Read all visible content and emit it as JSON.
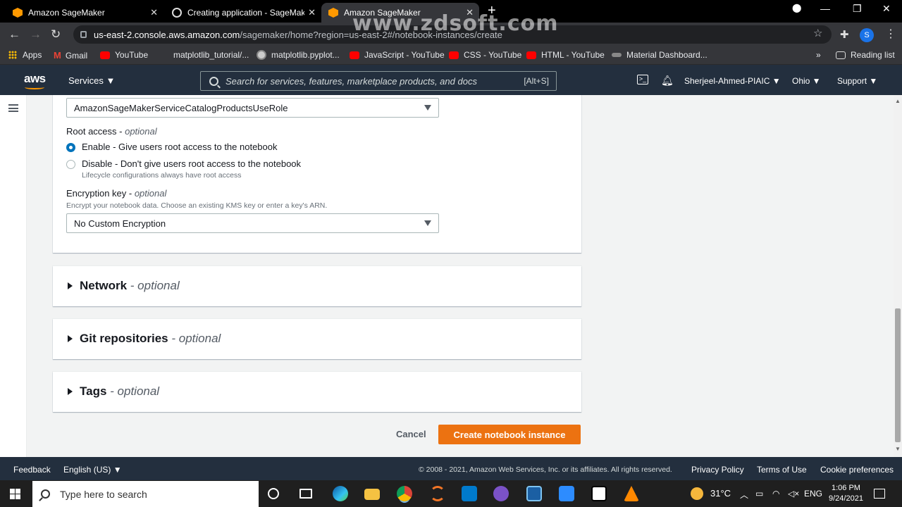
{
  "browser": {
    "tabs": [
      {
        "title": "Amazon SageMaker",
        "icon": "aws-hex-icon"
      },
      {
        "title": "Creating application - SageMake",
        "icon": "globe-icon"
      },
      {
        "title": "Amazon SageMaker",
        "icon": "aws-hex-icon"
      }
    ],
    "close_glyph": "✕",
    "url_host": "us-east-2.console.aws.amazon.com",
    "url_path": "/sagemaker/home?region=us-east-2#/notebook-instances/create",
    "watermark": "www.zdsoft.com",
    "profile_initial": "S",
    "bookmarks": [
      "Apps",
      "Gmail",
      "YouTube",
      "matplotlib_tutorial/...",
      "matplotlib.pyplot...",
      "JavaScript - YouTube",
      "CSS - YouTube",
      "HTML - YouTube",
      "Material Dashboard...",
      "Reading list"
    ]
  },
  "aws_header": {
    "logo": "aws",
    "services": "Services ▼",
    "search_placeholder": "Search for services, features, marketplace products, and docs",
    "search_shortcut": "[Alt+S]",
    "account": "Sherjeel-Ahmed-PIAIC ▼",
    "region": "Ohio ▼",
    "support": "Support ▼"
  },
  "form": {
    "role_select": "AmazonSageMakerServiceCatalogProductsUseRole",
    "root_access_label": "Root access - ",
    "optional": "optional",
    "enable_label": "Enable - Give users root access to the notebook",
    "disable_label": "Disable - Don't give users root access to the notebook",
    "disable_desc": "Lifecycle configurations always have root access",
    "encryption_label": "Encryption key - ",
    "encryption_desc": "Encrypt your notebook data. Choose an existing KMS key or enter a key's ARN.",
    "encryption_select": "No Custom Encryption",
    "sections": [
      {
        "title": "Network",
        "optional": " - optional"
      },
      {
        "title": "Git repositories",
        "optional": " - optional"
      },
      {
        "title": "Tags",
        "optional": " - optional"
      }
    ],
    "cancel": "Cancel",
    "create": "Create notebook instance"
  },
  "footer": {
    "feedback": "Feedback",
    "language": "English (US) ▼",
    "copyright": "© 2008 - 2021, Amazon Web Services, Inc. or its affiliates. All rights reserved.",
    "privacy": "Privacy Policy",
    "terms": "Terms of Use",
    "cookies": "Cookie preferences"
  },
  "taskbar": {
    "search_placeholder": "Type here to search",
    "weather": "31°C",
    "lang": "ENG",
    "time": "1:06 PM",
    "date": "9/24/2021"
  },
  "colors": {
    "aws_orange": "#ec7211",
    "aws_navy": "#232f3e",
    "link_blue": "#0073bb"
  }
}
